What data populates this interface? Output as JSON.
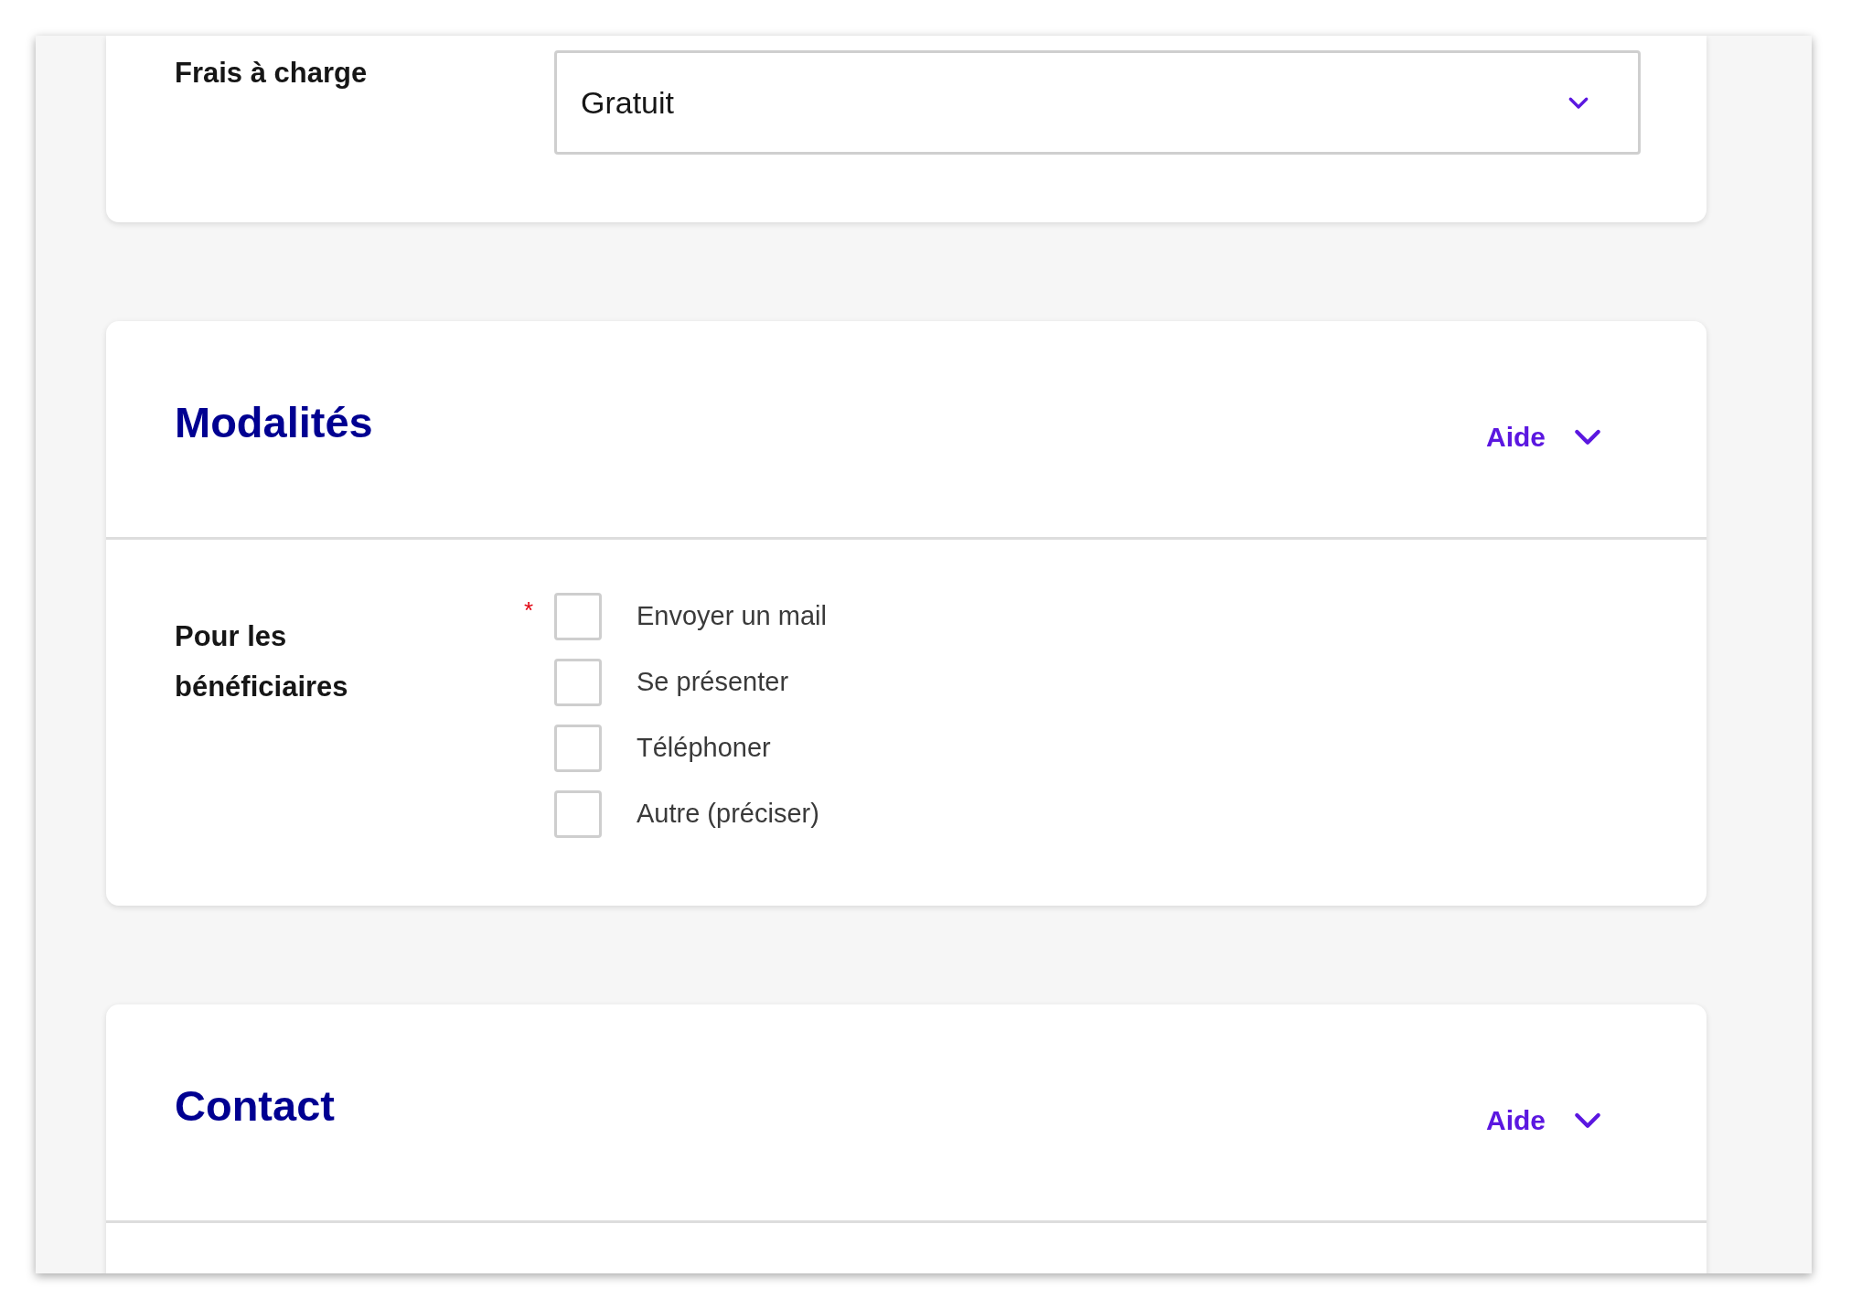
{
  "fee_field": {
    "label": "Frais à charge",
    "value": "Gratuit"
  },
  "sections": [
    {
      "title": "Modalités",
      "help": "Aide",
      "expanded": false,
      "field": {
        "label": "Pour les bénéficiaires",
        "required": true,
        "required_mark": "*",
        "options": [
          {
            "label": "Envoyer un mail",
            "checked": false
          },
          {
            "label": "Se présenter",
            "checked": false
          },
          {
            "label": "Téléphoner",
            "checked": false
          },
          {
            "label": "Autre (préciser)",
            "checked": false
          }
        ]
      }
    },
    {
      "title": "Contact",
      "help": "Aide",
      "expanded": false
    }
  ]
}
